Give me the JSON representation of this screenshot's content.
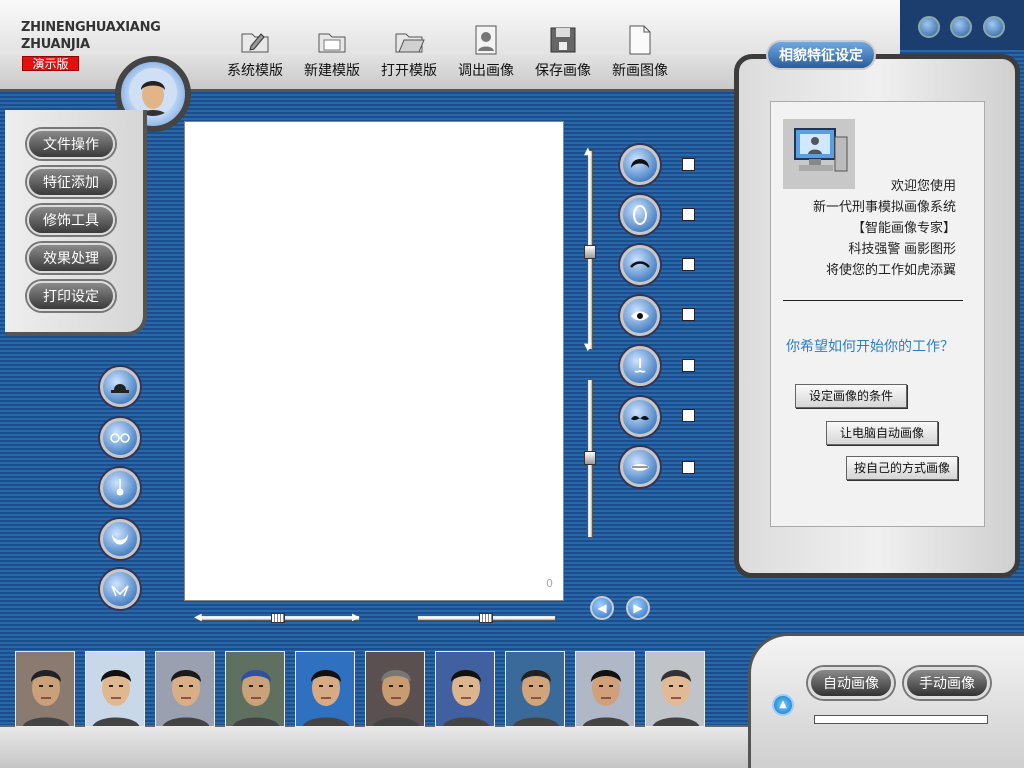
{
  "header": {
    "logo_line1": "ZHINENGHUAXIANG",
    "logo_line2": "ZHUANJIA",
    "demo_badge": "演示版"
  },
  "toolbar": [
    {
      "label": "系统模版",
      "icon": "folder-pencil-icon"
    },
    {
      "label": "新建模版",
      "icon": "folder-new-icon"
    },
    {
      "label": "打开模版",
      "icon": "folder-open-icon"
    },
    {
      "label": "调出画像",
      "icon": "portrait-load-icon"
    },
    {
      "label": "保存画像",
      "icon": "save-icon"
    },
    {
      "label": "新画图像",
      "icon": "new-page-icon"
    }
  ],
  "left_menu": [
    "文件操作",
    "特征添加",
    "修饰工具",
    "效果处理",
    "打印设定"
  ],
  "left_tools": [
    "hat-icon",
    "glasses-icon",
    "earring-icon",
    "beard-icon",
    "collar-icon"
  ],
  "feature_tools": [
    "hair-icon",
    "face-shape-icon",
    "eyebrow-icon",
    "eye-icon",
    "nose-icon",
    "mustache-icon",
    "mouth-icon"
  ],
  "canvas": {
    "counter": "0"
  },
  "right_panel": {
    "tab_title": "相貌特征设定",
    "welcome_lines": [
      "欢迎您使用",
      "新一代刑事模拟画像系统",
      "【智能画像专家】",
      "科技强警 画影图形",
      "将使您的工作如虎添翼"
    ],
    "question": "你希望如何开始你的工作？",
    "buttons": [
      "设定画像的条件",
      "让电脑自动画像",
      "按自己的方式画像"
    ]
  },
  "bottom": {
    "auto_button": "自动画像",
    "manual_button": "手动画像",
    "progress": 0
  },
  "thumbnails": 10,
  "colors": {
    "accent_blue": "#2e7fc8",
    "demo_red": "#e31010",
    "background_blue": "#1d4f8c"
  }
}
